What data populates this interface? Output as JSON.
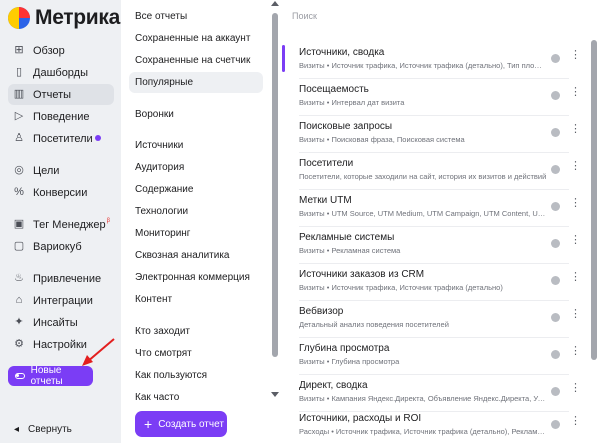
{
  "brand": {
    "name": "Метрика"
  },
  "nav": {
    "items": [
      {
        "label": "Обзор",
        "icon": "grid-icon",
        "glyph": "⊞"
      },
      {
        "label": "Дашборды",
        "icon": "dashboard-icon",
        "glyph": "▯"
      },
      {
        "label": "Отчеты",
        "icon": "bar-chart-icon",
        "glyph": "▥",
        "active": true
      },
      {
        "label": "Поведение",
        "icon": "play-icon",
        "glyph": "▷"
      },
      {
        "label": "Посетители",
        "icon": "user-icon",
        "glyph": "♙",
        "dot": true
      },
      {
        "label": "Цели",
        "icon": "target-icon",
        "glyph": "◎"
      },
      {
        "label": "Конверсии",
        "icon": "percent-icon",
        "glyph": "%"
      },
      {
        "label": "Тег Менеджер",
        "icon": "tag-icon",
        "glyph": "▣",
        "sup": "β"
      },
      {
        "label": "Вариокуб",
        "icon": "cube-icon",
        "glyph": "▢"
      },
      {
        "label": "Привлечение",
        "icon": "flame-icon",
        "glyph": "♨"
      },
      {
        "label": "Интеграции",
        "icon": "puzzle-icon",
        "glyph": "⌂"
      },
      {
        "label": "Инсайты",
        "icon": "sparkle-icon",
        "glyph": "✦"
      },
      {
        "label": "Настройки",
        "icon": "gear-icon",
        "glyph": "⚙"
      }
    ],
    "new_reports_label": "Новые отчеты",
    "collapse_label": "Свернуть",
    "collapse_glyph": "◂"
  },
  "categories": {
    "items": [
      {
        "label": "Все отчеты"
      },
      {
        "label": "Сохраненные на аккаунт"
      },
      {
        "label": "Сохраненные на счетчик"
      },
      {
        "label": "Популярные",
        "active": true
      },
      {
        "label": "Воронки"
      },
      {
        "label": "Источники"
      },
      {
        "label": "Аудитория"
      },
      {
        "label": "Содержание"
      },
      {
        "label": "Технологии"
      },
      {
        "label": "Мониторинг"
      },
      {
        "label": "Сквозная аналитика"
      },
      {
        "label": "Электронная коммерция"
      },
      {
        "label": "Контент"
      },
      {
        "label": "Кто заходит"
      },
      {
        "label": "Что смотрят"
      },
      {
        "label": "Как пользуются"
      },
      {
        "label": "Как часто"
      }
    ],
    "create_label": "Создать отчет",
    "create_glyph": "+"
  },
  "reports": {
    "search_placeholder": "Поиск",
    "items": [
      {
        "title": "Источники, сводка",
        "subtitle": "Визиты • Источник трафика, Источник трафика (детально), Тип площа...",
        "active": true
      },
      {
        "title": "Посещаемость",
        "subtitle": "Визиты • Интервал дат визита"
      },
      {
        "title": "Поисковые запросы",
        "subtitle": "Визиты • Поисковая фраза, Поисковая система"
      },
      {
        "title": "Посетители",
        "subtitle": "Посетители, которые заходили на сайт, история их визитов и действий"
      },
      {
        "title": "Метки UTM",
        "subtitle": "Визиты • UTM Source, UTM Medium, UTM Campaign, UTM Content, UTM..."
      },
      {
        "title": "Рекламные системы",
        "subtitle": "Визиты • Рекламная система"
      },
      {
        "title": "Источники заказов из CRM",
        "subtitle": "Визиты • Источник трафика, Источник трафика (детально)"
      },
      {
        "title": "Вебвизор",
        "subtitle": "Детальный анализ поведения посетителей"
      },
      {
        "title": "Глубина просмотра",
        "subtitle": "Визиты • Глубина просмотра"
      },
      {
        "title": "Директ, сводка",
        "subtitle": "Визиты • Кампания Яндекс.Директа, Объявление Яндекс.Директа, Усл..."
      },
      {
        "title": "Источники, расходы и ROI",
        "subtitle": "Расходы • Источник трафика, Источник трафика (детально), Рекламны..."
      }
    ],
    "more_glyph": "⋮"
  },
  "colors": {
    "accent": "#7b3df5",
    "sidebar_bg": "#eef0f3",
    "panel_bg": "#ffffff"
  }
}
